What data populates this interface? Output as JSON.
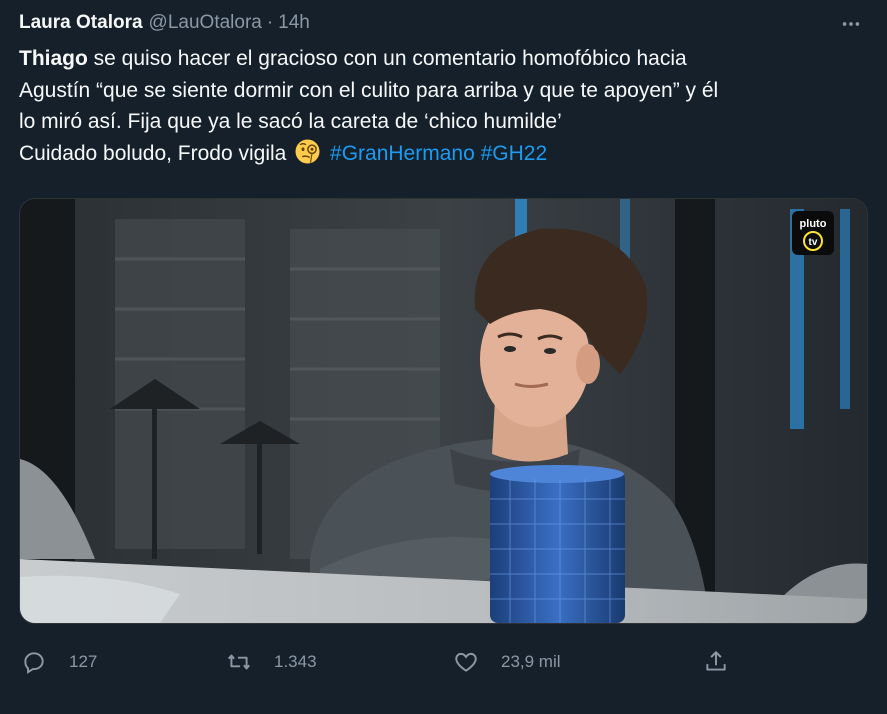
{
  "tweet": {
    "author": "Laura Otalora",
    "handle": "@LauOtalora",
    "separator": "·",
    "time": "14h",
    "text_bold": "Thiago",
    "text_line1": " se quiso hacer el gracioso con un comentario homofóbico hacia",
    "text_line2": "Agustín “que se siente dormir con el culito para arriba y que te apoyen” y él",
    "text_line3": "lo miró así. Fija que ya le sacó la careta de ‘chico humilde’",
    "text_line4": "Cuidado boludo, Frodo vigila",
    "emoji_icon": "face-with-monocle-icon",
    "hashtags": [
      "#GranHermano",
      "#GH22"
    ]
  },
  "media": {
    "watermark_line1": "pluto",
    "watermark_line2": "tv"
  },
  "actions": {
    "reply_count": "127",
    "retweet_count": "1.343",
    "like_count": "23,9 mil"
  },
  "colors": {
    "background": "#15202b",
    "text": "#f7f9f9",
    "muted": "#8b98a5",
    "link": "#1d9bf0"
  }
}
